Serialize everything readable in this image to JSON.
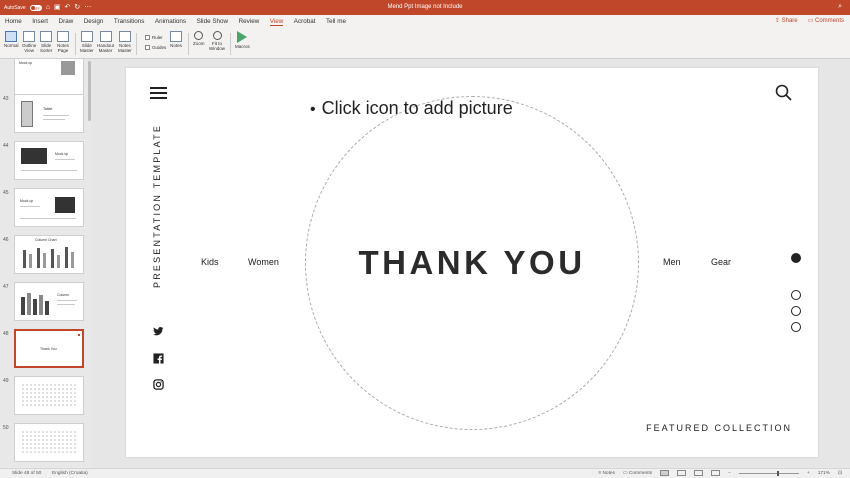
{
  "titlebar": {
    "autosave_label": "AutoSave",
    "autosave_state": "OFF",
    "doc_title": "Mend Ppt Image not Include",
    "window_icons": [
      "home-icon",
      "save-icon",
      "undo-icon",
      "redo-icon",
      "customize-icon"
    ],
    "search_icon": "search-icon"
  },
  "menubar": {
    "tabs": [
      "Home",
      "Insert",
      "Draw",
      "Design",
      "Transitions",
      "Animations",
      "Slide Show",
      "Review",
      "View",
      "Acrobat",
      "Tell me"
    ],
    "active_tab": "View",
    "share": "Share",
    "comments": "Comments"
  },
  "ribbon": {
    "normal": "Normal",
    "outline": "Outline",
    "outline2": "View",
    "sorter": "Slide",
    "sorter2": "Sorter",
    "notes_page": "Notes",
    "notes_page2": "Page",
    "slide_master": "Slide",
    "slide_master2": "Master",
    "handout": "Handout",
    "handout2": "Master",
    "notes_master": "Notes",
    "notes_master2": "Master",
    "ruler": "Ruler",
    "guides": "Guides",
    "notes": "Notes",
    "zoom": "Zoom",
    "fit": "Fit to",
    "fit2": "Window",
    "macros": "Macros"
  },
  "thumbnails": [
    {
      "num": "",
      "title": "Mock up"
    },
    {
      "num": "43",
      "title": "Tablet"
    },
    {
      "num": "44",
      "title": "Mock up"
    },
    {
      "num": "45",
      "title": "Mock up"
    },
    {
      "num": "46",
      "title": "Column Chart"
    },
    {
      "num": "47",
      "title": "Column"
    },
    {
      "num": "48",
      "title": "Thank You"
    },
    {
      "num": "49",
      "title": ""
    },
    {
      "num": "50",
      "title": ""
    }
  ],
  "slide": {
    "placeholder": "Click icon to add picture",
    "vertical_text": "PRESENTATION TEMPLATE",
    "heading": "THANK YOU",
    "nav_left": [
      "Kids",
      "Women"
    ],
    "nav_right": [
      "Men",
      "Gear"
    ],
    "footer": "FEATURED COLLECTION",
    "social_icons": [
      "twitter-icon",
      "facebook-icon",
      "instagram-icon"
    ],
    "dots_active_index": 0
  },
  "statusbar": {
    "slide_info": "Slide 48 of 50",
    "language": "English (Croatia)",
    "notes": "Notes",
    "comments": "Comments",
    "zoom": "171%"
  }
}
